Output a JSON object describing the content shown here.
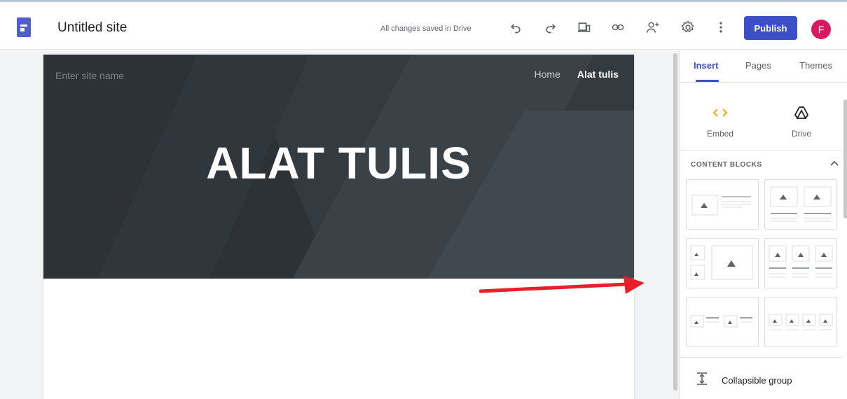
{
  "topbar": {
    "site_title": "Untitled site",
    "save_status": "All changes saved in Drive",
    "publish_label": "Publish",
    "avatar_initial": "F",
    "icons": [
      "undo-icon",
      "redo-icon",
      "preview-icon",
      "link-icon",
      "share-icon",
      "settings-icon",
      "more-vert-icon"
    ]
  },
  "page": {
    "site_name_placeholder": "Enter site name",
    "nav": [
      "Home",
      "Alat tulis"
    ],
    "hero_title": "ALAT TULIS"
  },
  "panel": {
    "tabs": [
      "Insert",
      "Pages",
      "Themes"
    ],
    "insert_items": [
      {
        "label": "Embed",
        "icon": "embed-code-icon"
      },
      {
        "label": "Drive",
        "icon": "drive-icon"
      }
    ],
    "content_blocks_title": "CONTENT BLOCKS",
    "collapsible_label": "Collapsible group"
  },
  "colors": {
    "accent": "#3c4fc6",
    "avatar": "#d81b60",
    "header_bg": "#343b40",
    "arrow": "#e8202a",
    "embed_icon": "#f9ab00"
  }
}
